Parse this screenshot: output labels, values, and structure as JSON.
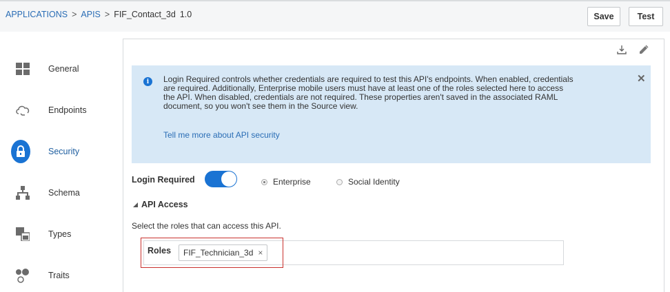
{
  "breadcrumb": {
    "applications": "APPLICATIONS",
    "sep1": ">",
    "apis": "APIS",
    "sep2": ">",
    "current": "FIF_Contact_3d",
    "version": "1.0"
  },
  "toolbar": {
    "save_label": "Save",
    "test_label": "Test"
  },
  "sidebar": {
    "items": [
      {
        "label": "General",
        "icon": "grid-icon"
      },
      {
        "label": "Endpoints",
        "icon": "cloud-link-icon"
      },
      {
        "label": "Security",
        "icon": "lock-icon",
        "active": true
      },
      {
        "label": "Schema",
        "icon": "hierarchy-icon"
      },
      {
        "label": "Types",
        "icon": "types-icon"
      },
      {
        "label": "Traits",
        "icon": "traits-icon"
      }
    ]
  },
  "main": {
    "info": {
      "text": "Login Required controls whether credentials are required to test this API's endpoints. When enabled, credentials are required. Additionally, Enterprise mobile users must have at least one of the roles selected here to access the API. When disabled, credentials are not required. These properties aren't saved in the associated RAML document, so you won't see them in the Source view.",
      "link": "Tell me more about API security",
      "close": "✕"
    },
    "login_required_label": "Login Required",
    "login_required_on": true,
    "radio_enterprise": "Enterprise",
    "radio_social": "Social Identity",
    "selected_radio": "Enterprise",
    "api_access_title": "API Access",
    "select_roles_text": "Select the roles that can access this API.",
    "roles_label": "Roles",
    "role_chip": "FIF_Technician_3d",
    "chip_remove": "×"
  },
  "colors": {
    "accent": "#1a73d3",
    "info_bg": "#d7e8f6",
    "link": "#2a6db5",
    "highlight": "#c9302c"
  }
}
